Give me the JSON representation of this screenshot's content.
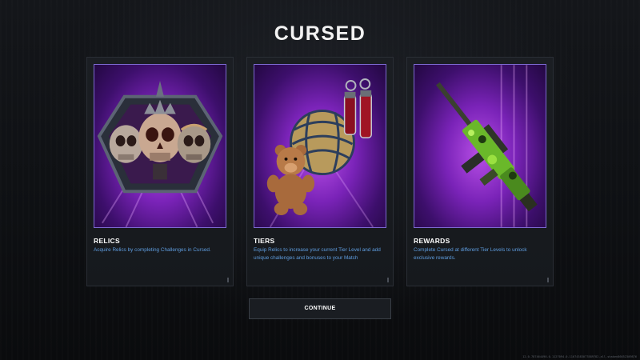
{
  "title": "CURSED",
  "cards": [
    {
      "heading": "RELICS",
      "description": "Acquire Relics by completing Challenges in Cursed.",
      "image": "three-skulls-relic-emblem"
    },
    {
      "heading": "TIERS",
      "description": "Equip Relics to increase your current Tier Level and add unique challenges and bonuses to your Match",
      "image": "teddy-bear-orb-and-vials"
    },
    {
      "heading": "REWARDS",
      "description": "Complete Cursed at different Tier Levels to unlock exclusive rewards.",
      "image": "green-camo-rifle"
    }
  ],
  "continue_label": "CONTINUE",
  "build_info": "12.0.787464490-0.1127094.0-11674383077889782.all.shaken86652309876",
  "colors": {
    "background": "#0d0f12",
    "card": "#1b1e23",
    "art_purple": "#7a23b8",
    "description_blue": "#5f9ee0",
    "frame": "#7d6ad0"
  }
}
